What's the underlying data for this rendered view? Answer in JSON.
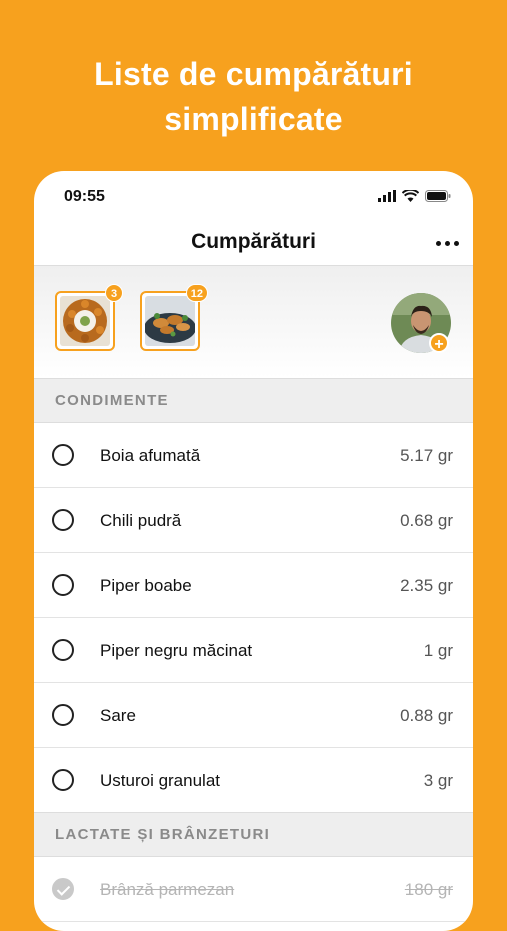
{
  "headline": {
    "line1": "Liste de cumpărături",
    "line2": "simplificate"
  },
  "status": {
    "time": "09:55"
  },
  "navbar": {
    "title": "Cumpărături"
  },
  "recipes": [
    {
      "icon": "bowl-dip-image",
      "count": "3"
    },
    {
      "icon": "chicken-plate-image",
      "count": "12"
    }
  ],
  "sections": [
    {
      "title": "CONDIMENTE",
      "items": [
        {
          "name": "Boia afumată",
          "qty": "5.17 gr",
          "checked": false
        },
        {
          "name": "Chili pudră",
          "qty": "0.68 gr",
          "checked": false
        },
        {
          "name": "Piper boabe",
          "qty": "2.35 gr",
          "checked": false
        },
        {
          "name": "Piper negru măcinat",
          "qty": "1 gr",
          "checked": false
        },
        {
          "name": "Sare",
          "qty": "0.88 gr",
          "checked": false
        },
        {
          "name": "Usturoi granulat",
          "qty": "3 gr",
          "checked": false
        }
      ]
    },
    {
      "title": "LACTATE ȘI BRÂNZETURI",
      "items": [
        {
          "name": "Brânză parmezan",
          "qty": "180 gr",
          "checked": true
        }
      ]
    }
  ],
  "colors": {
    "accent": "#F7A11E"
  }
}
